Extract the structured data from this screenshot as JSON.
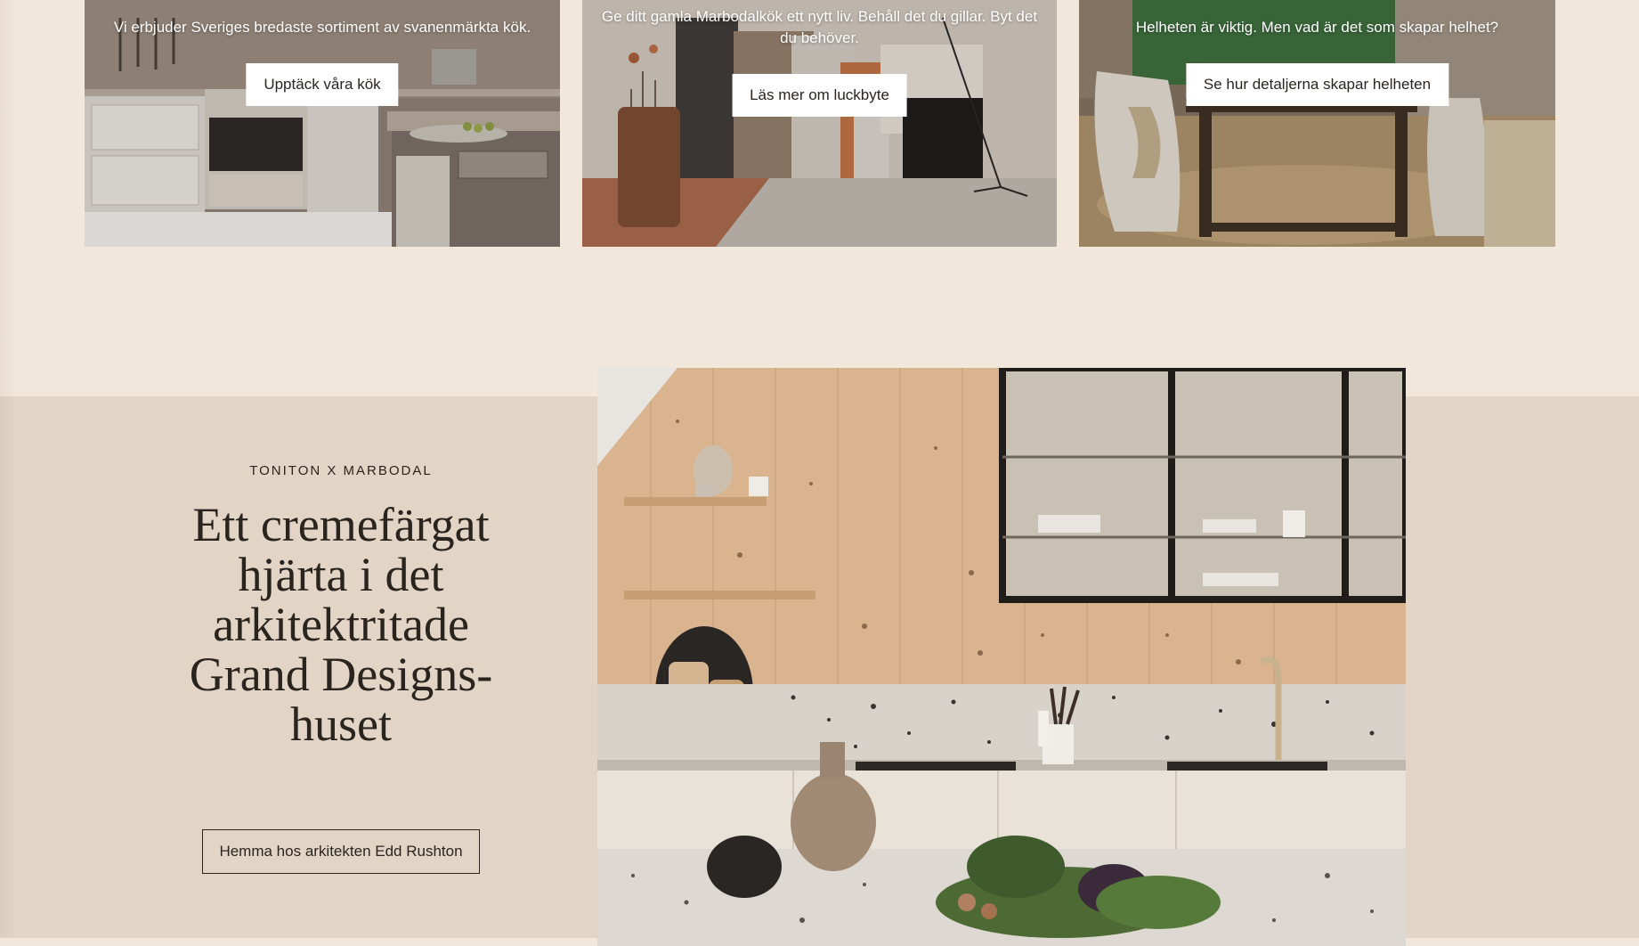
{
  "cards": [
    {
      "text": "Vi erbjuder Sveriges bredaste sortiment av svanenmärkta kök.",
      "button": "Upptäck våra kök",
      "image_icon": "kitchen-photo"
    },
    {
      "text": "Ge ditt gamla Marbodalkök ett nytt liv. Behåll det du gillar. Byt det du behöver.",
      "button": "Läs mer om luckbyte",
      "image_icon": "door-samples-photo"
    },
    {
      "text": "Helheten är viktig. Men vad är det som skapar helhet?",
      "button": "Se hur detaljerna skapar helheten",
      "image_icon": "dining-room-photo"
    }
  ],
  "feature": {
    "eyebrow": "TONITON X MARBODAL",
    "headline": "Ett cremefärgat hjärta i det arkitektritade Grand Designs-huset",
    "button": "Hemma hos arkitekten Edd Rushton",
    "image_icon": "cream-kitchen-photo"
  },
  "colors": {
    "page_bg": "#f1e7db",
    "band_bg": "#e3d5c6",
    "text": "#2a241f",
    "button_bg": "#ffffff"
  }
}
